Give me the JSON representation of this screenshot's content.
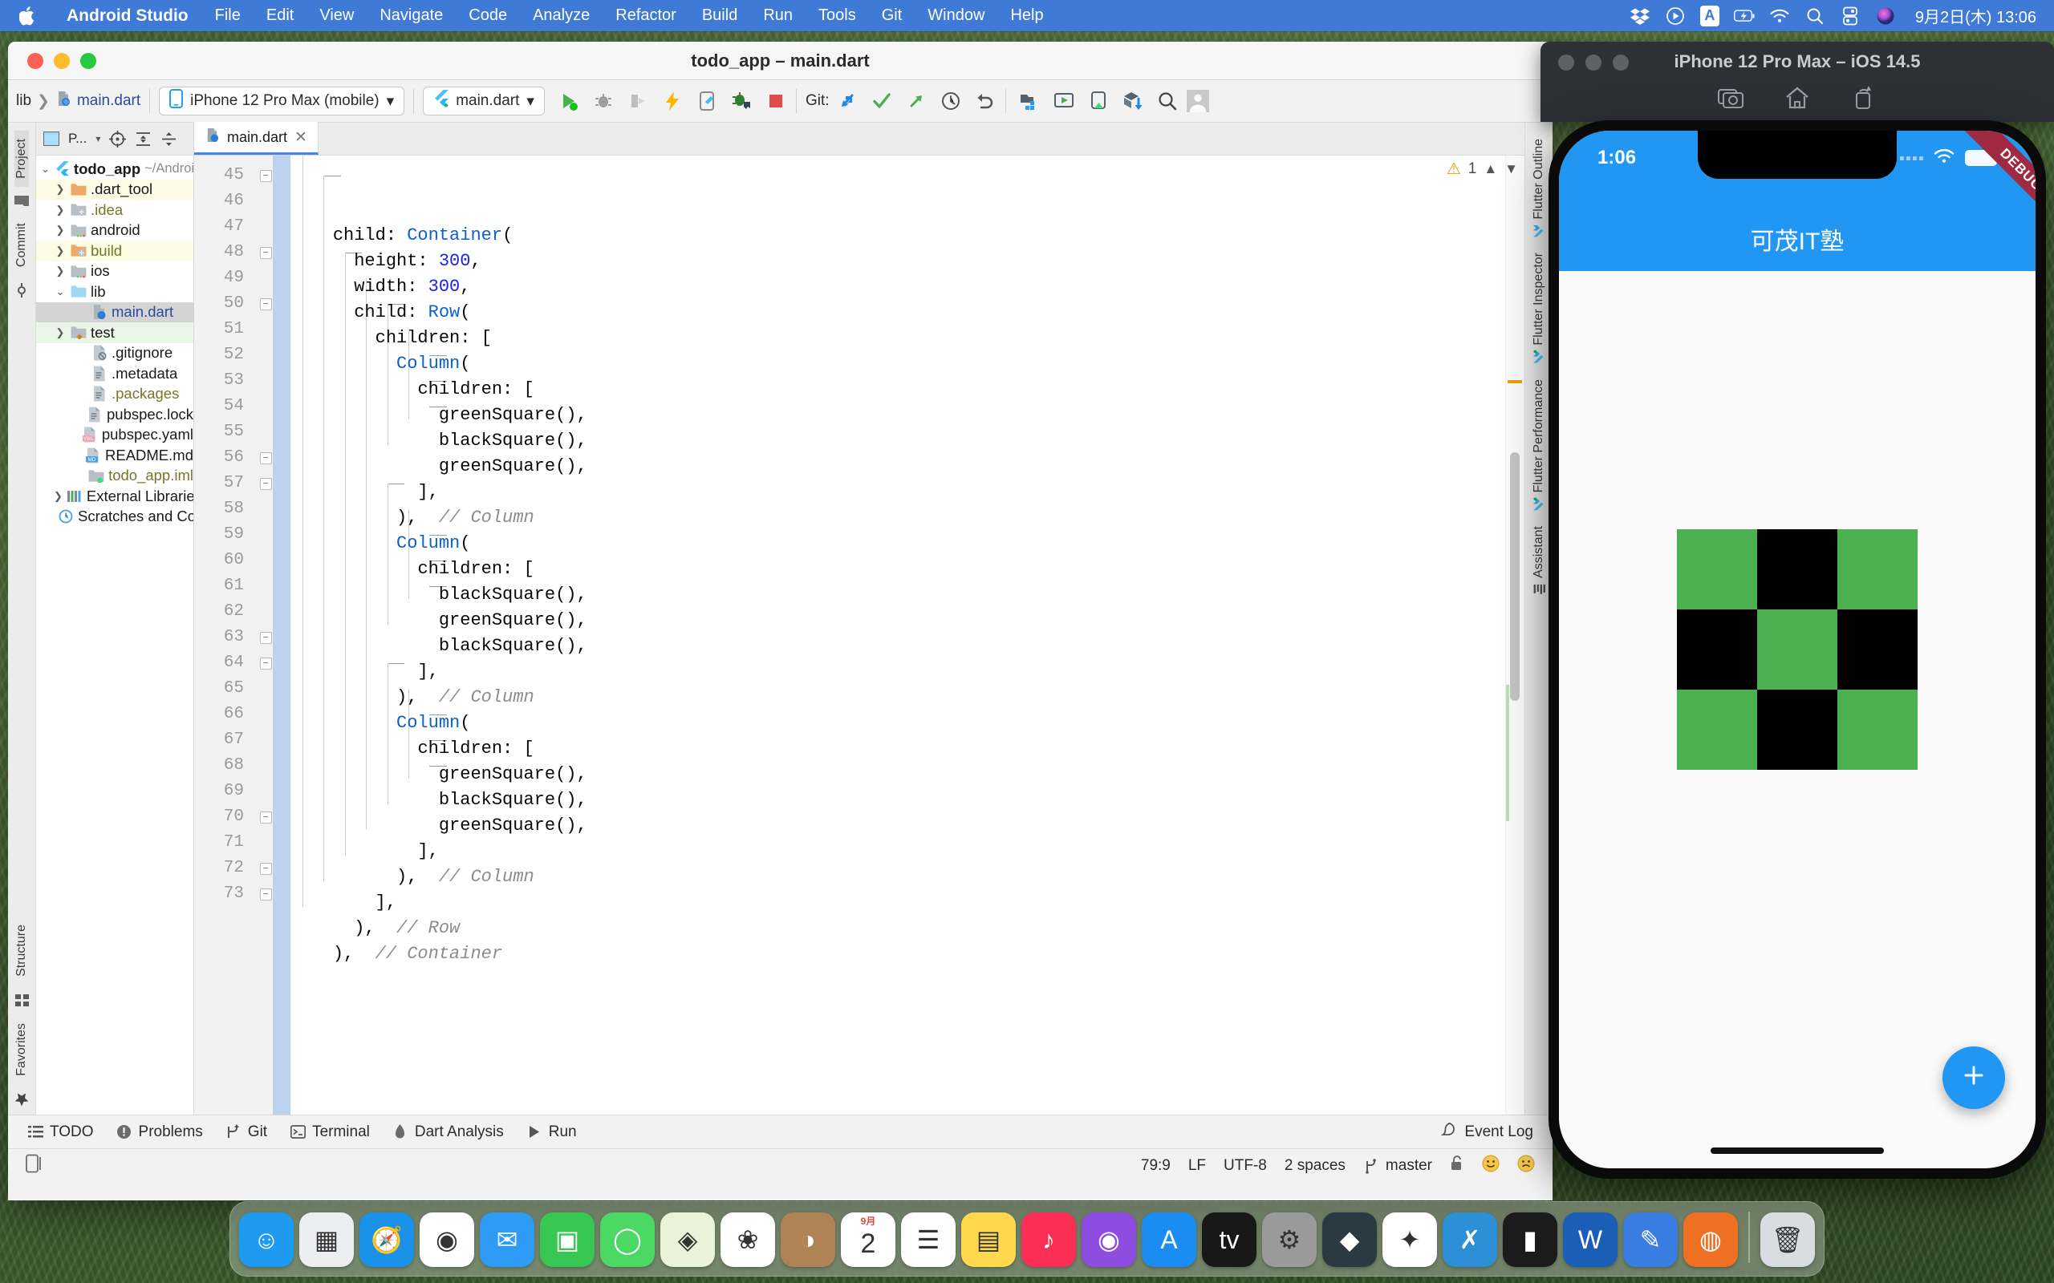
{
  "menubar": {
    "apple_icon": "apple-logo",
    "app_name": "Android Studio",
    "items": [
      "File",
      "Edit",
      "View",
      "Navigate",
      "Code",
      "Analyze",
      "Refactor",
      "Build",
      "Run",
      "Tools",
      "Git",
      "Window",
      "Help"
    ],
    "tray_icons": [
      "dropbox-icon",
      "play-circle-icon",
      "input-source-icon",
      "battery-charging-icon",
      "wifi-icon",
      "search-icon",
      "control-center-icon",
      "siri-icon"
    ],
    "input_source_label": "A",
    "clock": "9月2日(木) 13:06"
  },
  "ide": {
    "window_title": "todo_app – main.dart",
    "toolbar": {
      "breadcrumb": [
        "lib",
        "main.dart"
      ],
      "device_selector": "iPhone 12 Pro Max (mobile)",
      "run_config": "main.dart",
      "git_label": "Git:",
      "icons": [
        "run-icon",
        "debug-icon",
        "run-coverage-icon",
        "hot-reload-icon",
        "flutter-device-icon",
        "attach-debugger-icon",
        "stop-icon"
      ],
      "git_icons": [
        "update-project-icon",
        "commit-icon",
        "push-icon",
        "history-icon",
        "rollback-icon"
      ],
      "right_icons": [
        "project-structure-icon",
        "avd-manager-icon",
        "sdk-manager-icon",
        "search-everywhere-icon",
        "avatar-icon"
      ]
    },
    "left_rail": [
      "Project",
      "Commit"
    ],
    "left_rail_bottom": [
      "Structure",
      "Favorites"
    ],
    "right_rail": [
      "Flutter Outline",
      "Flutter Inspector",
      "Flutter Performance",
      "Assistant"
    ],
    "project_pane": {
      "title": "P...",
      "header_icons": [
        "select-opened-file-icon",
        "collapse-all-icon",
        "expand-all-icon",
        "settings-gear-icon"
      ],
      "tree": [
        {
          "label": "todo_app",
          "path": "~/Androi",
          "indent": 0,
          "arrow": "expanded",
          "icon": "flutter-icon",
          "style": "bold",
          "highlight": "none"
        },
        {
          "label": ".dart_tool",
          "indent": 1,
          "arrow": "collapsed",
          "icon": "folder-orange-icon",
          "style": "normal",
          "highlight": "yellow"
        },
        {
          "label": ".idea",
          "indent": 1,
          "arrow": "collapsed",
          "icon": "folder-idea-icon",
          "style": "olive",
          "highlight": "none"
        },
        {
          "label": "android",
          "indent": 1,
          "arrow": "collapsed",
          "icon": "folder-android-icon",
          "style": "normal",
          "highlight": "none"
        },
        {
          "label": "build",
          "indent": 1,
          "arrow": "collapsed",
          "icon": "folder-build-icon",
          "style": "olive",
          "highlight": "yellow"
        },
        {
          "label": "ios",
          "indent": 1,
          "arrow": "collapsed",
          "icon": "folder-ios-icon",
          "style": "normal",
          "highlight": "none"
        },
        {
          "label": "lib",
          "indent": 1,
          "arrow": "expanded",
          "icon": "folder-source-icon",
          "style": "normal",
          "highlight": "none"
        },
        {
          "label": "main.dart",
          "indent": 2,
          "arrow": "none",
          "icon": "dart-file-icon",
          "style": "blue",
          "highlight": "selected"
        },
        {
          "label": "test",
          "indent": 1,
          "arrow": "collapsed",
          "icon": "folder-test-icon",
          "style": "normal",
          "highlight": "green"
        },
        {
          "label": ".gitignore",
          "indent": 2,
          "arrow": "none",
          "icon": "file-ignored-icon",
          "style": "normal",
          "highlight": "none"
        },
        {
          "label": ".metadata",
          "indent": 2,
          "arrow": "none",
          "icon": "file-text-icon",
          "style": "normal",
          "highlight": "none"
        },
        {
          "label": ".packages",
          "indent": 2,
          "arrow": "none",
          "icon": "file-text-icon",
          "style": "olive",
          "highlight": "none"
        },
        {
          "label": "pubspec.lock",
          "indent": 2,
          "arrow": "none",
          "icon": "file-text-icon",
          "style": "normal",
          "highlight": "none"
        },
        {
          "label": "pubspec.yaml",
          "indent": 2,
          "arrow": "none",
          "icon": "yml-file-icon",
          "style": "normal",
          "highlight": "none"
        },
        {
          "label": "README.md",
          "indent": 2,
          "arrow": "none",
          "icon": "md-file-icon",
          "style": "normal",
          "highlight": "none"
        },
        {
          "label": "todo_app.iml",
          "indent": 2,
          "arrow": "none",
          "icon": "iml-file-icon",
          "style": "olive",
          "highlight": "none"
        },
        {
          "label": "External Libraries",
          "indent": 1,
          "arrow": "collapsed",
          "icon": "libraries-icon",
          "style": "normal",
          "highlight": "none"
        },
        {
          "label": "Scratches and Cons",
          "indent": 1,
          "arrow": "none",
          "icon": "scratches-icon",
          "style": "normal",
          "highlight": "none"
        }
      ]
    },
    "editor": {
      "tab_label": "main.dart",
      "tab_icon": "dart-file-icon",
      "warning_count": "1",
      "warning_icon": "warning-triangle-icon",
      "first_line_number": 45,
      "lines": [
        {
          "n": 45,
          "indent": 2,
          "fold": true,
          "tick": true,
          "segments": [
            {
              "t": "child: ",
              "c": "plain"
            },
            {
              "t": "Container",
              "c": "type"
            },
            {
              "t": "(",
              "c": "plain"
            }
          ]
        },
        {
          "n": 46,
          "indent": 3,
          "fold": false,
          "tick": false,
          "segments": [
            {
              "t": "height: ",
              "c": "plain"
            },
            {
              "t": "300",
              "c": "num"
            },
            {
              "t": ",",
              "c": "plain"
            }
          ]
        },
        {
          "n": 47,
          "indent": 3,
          "fold": false,
          "tick": false,
          "segments": [
            {
              "t": "width: ",
              "c": "plain"
            },
            {
              "t": "300",
              "c": "num"
            },
            {
              "t": ",",
              "c": "plain"
            }
          ]
        },
        {
          "n": 48,
          "indent": 3,
          "fold": true,
          "tick": true,
          "segments": [
            {
              "t": "child: ",
              "c": "plain"
            },
            {
              "t": "Row",
              "c": "type"
            },
            {
              "t": "(",
              "c": "plain"
            }
          ]
        },
        {
          "n": 49,
          "indent": 4,
          "fold": false,
          "tick": false,
          "segments": [
            {
              "t": "children: [",
              "c": "plain"
            }
          ]
        },
        {
          "n": 50,
          "indent": 5,
          "fold": true,
          "tick": true,
          "segments": [
            {
              "t": "Column",
              "c": "type"
            },
            {
              "t": "(",
              "c": "plain"
            }
          ]
        },
        {
          "n": 51,
          "indent": 6,
          "fold": false,
          "tick": false,
          "segments": [
            {
              "t": "children: [",
              "c": "plain"
            }
          ]
        },
        {
          "n": 52,
          "indent": 7,
          "fold": false,
          "tick": true,
          "segments": [
            {
              "t": "greenSquare(),",
              "c": "plain"
            }
          ]
        },
        {
          "n": 53,
          "indent": 7,
          "fold": false,
          "tick": true,
          "segments": [
            {
              "t": "blackSquare(),",
              "c": "plain"
            }
          ]
        },
        {
          "n": 54,
          "indent": 7,
          "fold": false,
          "tick": true,
          "segments": [
            {
              "t": "greenSquare(),",
              "c": "plain"
            }
          ]
        },
        {
          "n": 55,
          "indent": 6,
          "fold": false,
          "tick": false,
          "segments": [
            {
              "t": "],",
              "c": "plain"
            }
          ]
        },
        {
          "n": 56,
          "indent": 5,
          "fold": true,
          "tick": false,
          "segments": [
            {
              "t": "),  ",
              "c": "plain"
            },
            {
              "t": "// Column",
              "c": "cmt"
            }
          ]
        },
        {
          "n": 57,
          "indent": 5,
          "fold": true,
          "tick": true,
          "segments": [
            {
              "t": "Column",
              "c": "type"
            },
            {
              "t": "(",
              "c": "plain"
            }
          ]
        },
        {
          "n": 58,
          "indent": 6,
          "fold": false,
          "tick": false,
          "segments": [
            {
              "t": "children: [",
              "c": "plain"
            }
          ]
        },
        {
          "n": 59,
          "indent": 7,
          "fold": false,
          "tick": true,
          "segments": [
            {
              "t": "blackSquare(),",
              "c": "plain"
            }
          ]
        },
        {
          "n": 60,
          "indent": 7,
          "fold": false,
          "tick": true,
          "segments": [
            {
              "t": "greenSquare(),",
              "c": "plain"
            }
          ]
        },
        {
          "n": 61,
          "indent": 7,
          "fold": false,
          "tick": true,
          "segments": [
            {
              "t": "blackSquare(),",
              "c": "plain"
            }
          ]
        },
        {
          "n": 62,
          "indent": 6,
          "fold": false,
          "tick": false,
          "segments": [
            {
              "t": "],",
              "c": "plain"
            }
          ]
        },
        {
          "n": 63,
          "indent": 5,
          "fold": true,
          "tick": false,
          "segments": [
            {
              "t": "),  ",
              "c": "plain"
            },
            {
              "t": "// Column",
              "c": "cmt"
            }
          ]
        },
        {
          "n": 64,
          "indent": 5,
          "fold": true,
          "tick": true,
          "segments": [
            {
              "t": "Column",
              "c": "type"
            },
            {
              "t": "(",
              "c": "plain"
            }
          ]
        },
        {
          "n": 65,
          "indent": 6,
          "fold": false,
          "tick": false,
          "segments": [
            {
              "t": "children: [",
              "c": "plain"
            }
          ]
        },
        {
          "n": 66,
          "indent": 7,
          "fold": false,
          "tick": true,
          "segments": [
            {
              "t": "greenSquare(),",
              "c": "plain"
            }
          ]
        },
        {
          "n": 67,
          "indent": 7,
          "fold": false,
          "tick": true,
          "segments": [
            {
              "t": "blackSquare(),",
              "c": "plain"
            }
          ]
        },
        {
          "n": 68,
          "indent": 7,
          "fold": false,
          "tick": true,
          "segments": [
            {
              "t": "greenSquare(),",
              "c": "plain"
            }
          ]
        },
        {
          "n": 69,
          "indent": 6,
          "fold": false,
          "tick": false,
          "segments": [
            {
              "t": "],",
              "c": "plain"
            }
          ]
        },
        {
          "n": 70,
          "indent": 5,
          "fold": true,
          "tick": false,
          "segments": [
            {
              "t": "),  ",
              "c": "plain"
            },
            {
              "t": "// Column",
              "c": "cmt"
            }
          ]
        },
        {
          "n": 71,
          "indent": 4,
          "fold": false,
          "tick": false,
          "segments": [
            {
              "t": "],",
              "c": "plain"
            }
          ]
        },
        {
          "n": 72,
          "indent": 3,
          "fold": true,
          "tick": false,
          "segments": [
            {
              "t": "),  ",
              "c": "plain"
            },
            {
              "t": "// Row",
              "c": "cmt"
            }
          ]
        },
        {
          "n": 73,
          "indent": 2,
          "fold": true,
          "tick": false,
          "segments": [
            {
              "t": "),  ",
              "c": "plain"
            },
            {
              "t": "// Container",
              "c": "cmt"
            }
          ]
        }
      ]
    },
    "bottom_bar": {
      "items": [
        {
          "label": "TODO",
          "icon": "todo-list-icon"
        },
        {
          "label": "Problems",
          "icon": "problems-icon"
        },
        {
          "label": "Git",
          "icon": "git-branch-icon"
        },
        {
          "label": "Terminal",
          "icon": "terminal-icon"
        },
        {
          "label": "Dart Analysis",
          "icon": "dart-icon"
        },
        {
          "label": "Run",
          "icon": "run-play-icon"
        }
      ],
      "event_log": "Event Log",
      "event_log_icon": "event-log-icon"
    },
    "statusbar": {
      "left_icon": "device-frame-icon",
      "caret_position": "79:9",
      "line_separator": "LF",
      "encoding": "UTF-8",
      "indent": "2 spaces",
      "branch": "master",
      "branch_icon": "git-branch-icon",
      "lock_icon": "unlocked-icon",
      "faces": [
        "happy-face-icon",
        "sad-face-icon"
      ]
    }
  },
  "simulator": {
    "window_title": "iPhone 12 Pro Max – iOS 14.5",
    "toolbar_icons": [
      "screenshot-icon",
      "home-icon",
      "rotate-icon"
    ],
    "device": {
      "status_time": "1:06",
      "status_icons": [
        "signal-icon",
        "wifi-icon",
        "battery-icon"
      ],
      "appbar_title": "可茂IT塾",
      "debug_banner": "DEBUG",
      "fab_icon": "plus-icon",
      "accent_color": "#2196f3",
      "green_color": "#4caf50",
      "black_color": "#000000",
      "grid": [
        [
          "green",
          "black",
          "green"
        ],
        [
          "black",
          "green",
          "black"
        ],
        [
          "green",
          "black",
          "green"
        ]
      ]
    }
  },
  "dock": {
    "apps": [
      {
        "name": "finder-icon",
        "color": "#1e9bf0",
        "glyph": "☺"
      },
      {
        "name": "launchpad-icon",
        "color": "#eceef1",
        "glyph": "▦"
      },
      {
        "name": "safari-icon",
        "color": "#1a92e8",
        "glyph": "🧭"
      },
      {
        "name": "chrome-icon",
        "color": "#ffffff",
        "glyph": "◉"
      },
      {
        "name": "mail-icon",
        "color": "#2e9cf4",
        "glyph": "✉"
      },
      {
        "name": "facetime-icon",
        "color": "#37c752",
        "glyph": "▣"
      },
      {
        "name": "messages-icon",
        "color": "#4bd964",
        "glyph": "◯"
      },
      {
        "name": "maps-icon",
        "color": "#e8f3d8",
        "glyph": "◈"
      },
      {
        "name": "photos-icon",
        "color": "#ffffff",
        "glyph": "❀"
      },
      {
        "name": "contacts-icon",
        "color": "#b08356",
        "glyph": "◑"
      },
      {
        "name": "calendar-icon",
        "color": "#ffffff",
        "glyph": "2",
        "top_label": "9月"
      },
      {
        "name": "reminders-icon",
        "color": "#ffffff",
        "glyph": "☰"
      },
      {
        "name": "notes-icon",
        "color": "#ffd84d",
        "glyph": "▤"
      },
      {
        "name": "music-icon",
        "color": "#fb2f55",
        "glyph": "♪"
      },
      {
        "name": "podcasts-icon",
        "color": "#8e4ce0",
        "glyph": "◉"
      },
      {
        "name": "appstore-icon",
        "color": "#1b8df2",
        "glyph": "A"
      },
      {
        "name": "appletv-icon",
        "color": "#181818",
        "glyph": "tv"
      },
      {
        "name": "system-preferences-icon",
        "color": "#9a9a9a",
        "glyph": "⚙"
      },
      {
        "name": "android-studio-icon",
        "color": "#2b3a42",
        "glyph": "◆"
      },
      {
        "name": "slack-icon",
        "color": "#ffffff",
        "glyph": "✦"
      },
      {
        "name": "vscode-icon",
        "color": "#2d8fd5",
        "glyph": "✗"
      },
      {
        "name": "simulator-icon",
        "color": "#1b1b1b",
        "glyph": "▮"
      },
      {
        "name": "word-icon",
        "color": "#1b5eb6",
        "glyph": "W"
      },
      {
        "name": "xcode-icon",
        "color": "#3a7de0",
        "glyph": "✎"
      },
      {
        "name": "firefox-icon",
        "color": "#ef7022",
        "glyph": "◍"
      },
      {
        "name": "trash-icon",
        "color": "#d8dde2",
        "glyph": "🗑"
      }
    ]
  }
}
